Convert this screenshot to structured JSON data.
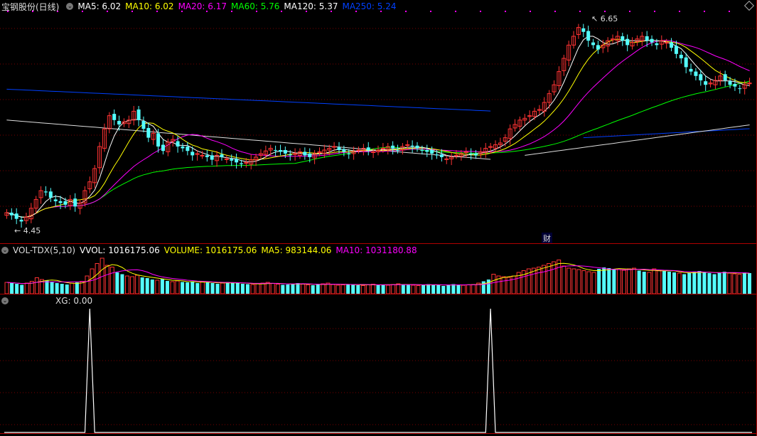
{
  "main": {
    "title": "宝钢股份(日线)",
    "indicators": [
      {
        "label": "MA5: 6.02",
        "color": "#ffffff"
      },
      {
        "label": "MA10: 6.02",
        "color": "#ffff00"
      },
      {
        "label": "MA20: 6.17",
        "color": "#ff00ff"
      },
      {
        "label": "MA60: 5.76",
        "color": "#00ff00"
      },
      {
        "label": "MA120: 5.37",
        "color": "#ffffff"
      },
      {
        "label": "MA250: 5.24",
        "color": "#0040ff"
      }
    ],
    "high_label": "6.65",
    "low_label": "4.45",
    "event_marker": "财"
  },
  "volume": {
    "title": "VOL-TDX(5,10)",
    "indicators": [
      {
        "label": "VVOL: 1016175.06",
        "color": "#ffffff"
      },
      {
        "label": "VOLUME: 1016175.06",
        "color": "#ffff00"
      },
      {
        "label": "MA5: 983144.06",
        "color": "#ffff00"
      },
      {
        "label": "MA10: 1031180.88",
        "color": "#ff00ff"
      }
    ]
  },
  "xg": {
    "title": "XG: 0.00"
  },
  "colors": {
    "up": "#ff3333",
    "down": "#54ffff",
    "grid": "#7a0000",
    "separator": "#b00000"
  },
  "chart_data": [
    {
      "type": "candlestick",
      "price_range": [
        4.45,
        6.65
      ],
      "close": [
        4.55,
        4.52,
        4.48,
        4.45,
        4.5,
        4.6,
        4.7,
        4.8,
        4.78,
        4.72,
        4.68,
        4.66,
        4.64,
        4.7,
        4.62,
        4.66,
        4.8,
        4.9,
        5.05,
        5.3,
        5.5,
        5.65,
        5.6,
        5.55,
        5.58,
        5.6,
        5.7,
        5.6,
        5.5,
        5.4,
        5.45,
        5.3,
        5.25,
        5.35,
        5.38,
        5.3,
        5.28,
        5.25,
        5.2,
        5.22,
        5.2,
        5.18,
        5.15,
        5.2,
        5.18,
        5.16,
        5.14,
        5.12,
        5.1,
        5.12,
        5.15,
        5.18,
        5.22,
        5.25,
        5.28,
        5.26,
        5.24,
        5.22,
        5.2,
        5.22,
        5.24,
        5.2,
        5.18,
        5.22,
        5.24,
        5.26,
        5.28,
        5.3,
        5.26,
        5.24,
        5.22,
        5.24,
        5.26,
        5.28,
        5.26,
        5.24,
        5.26,
        5.28,
        5.3,
        5.28,
        5.26,
        5.3,
        5.32,
        5.3,
        5.28,
        5.26,
        5.24,
        5.22,
        5.2,
        5.18,
        5.16,
        5.18,
        5.2,
        5.22,
        5.24,
        5.22,
        5.2,
        5.24,
        5.28,
        5.3,
        5.32,
        5.34,
        5.4,
        5.5,
        5.55,
        5.6,
        5.62,
        5.65,
        5.7,
        5.72,
        5.8,
        5.9,
        6.0,
        6.15,
        6.3,
        6.45,
        6.55,
        6.65,
        6.6,
        6.5,
        6.45,
        6.4,
        6.45,
        6.5,
        6.52,
        6.55,
        6.5,
        6.45,
        6.48,
        6.52,
        6.55,
        6.5,
        6.48,
        6.45,
        6.5,
        6.48,
        6.42,
        6.35,
        6.3,
        6.2,
        6.15,
        6.1,
        6.05,
        6.0,
        6.02,
        6.05,
        6.1,
        6.05,
        6.0,
        5.98,
        5.96,
        6.0,
        6.02
      ]
    },
    {
      "type": "bar",
      "name": "VOLUME",
      "values": [
        0.32,
        0.3,
        0.28,
        0.25,
        0.3,
        0.35,
        0.45,
        0.4,
        0.38,
        0.34,
        0.3,
        0.28,
        0.26,
        0.3,
        0.32,
        0.35,
        0.5,
        0.7,
        0.85,
        1.0,
        0.8,
        0.75,
        0.6,
        0.55,
        0.5,
        0.48,
        0.52,
        0.46,
        0.44,
        0.4,
        0.38,
        0.42,
        0.36,
        0.34,
        0.36,
        0.33,
        0.32,
        0.35,
        0.3,
        0.34,
        0.32,
        0.3,
        0.28,
        0.3,
        0.33,
        0.31,
        0.3,
        0.28,
        0.27,
        0.26,
        0.28,
        0.3,
        0.32,
        0.29,
        0.27,
        0.25,
        0.26,
        0.28,
        0.3,
        0.27,
        0.25,
        0.24,
        0.26,
        0.28,
        0.3,
        0.26,
        0.24,
        0.25,
        0.27,
        0.26,
        0.24,
        0.23,
        0.25,
        0.27,
        0.26,
        0.25,
        0.24,
        0.26,
        0.28,
        0.27,
        0.25,
        0.24,
        0.23,
        0.25,
        0.27,
        0.26,
        0.24,
        0.22,
        0.25,
        0.27,
        0.26,
        0.24,
        0.25,
        0.26,
        0.3,
        0.35,
        0.4,
        0.55,
        0.5,
        0.48,
        0.46,
        0.5,
        0.6,
        0.65,
        0.7,
        0.72,
        0.75,
        0.8,
        0.85,
        0.9,
        0.95,
        0.78,
        0.72,
        0.7,
        0.68,
        0.65,
        0.62,
        0.6,
        0.7,
        0.74,
        0.72,
        0.7,
        0.68,
        0.66,
        0.7,
        0.72,
        0.65,
        0.62,
        0.6,
        0.7,
        0.66,
        0.64,
        0.62,
        0.6,
        0.58,
        0.55,
        0.6,
        0.62,
        0.64,
        0.6,
        0.58,
        0.55,
        0.6,
        0.62,
        0.58,
        0.56,
        0.55,
        0.6,
        0.58
      ]
    },
    {
      "type": "line",
      "name": "XG",
      "spike_indices": [
        17,
        99
      ],
      "ylim": [
        0,
        1
      ]
    }
  ]
}
